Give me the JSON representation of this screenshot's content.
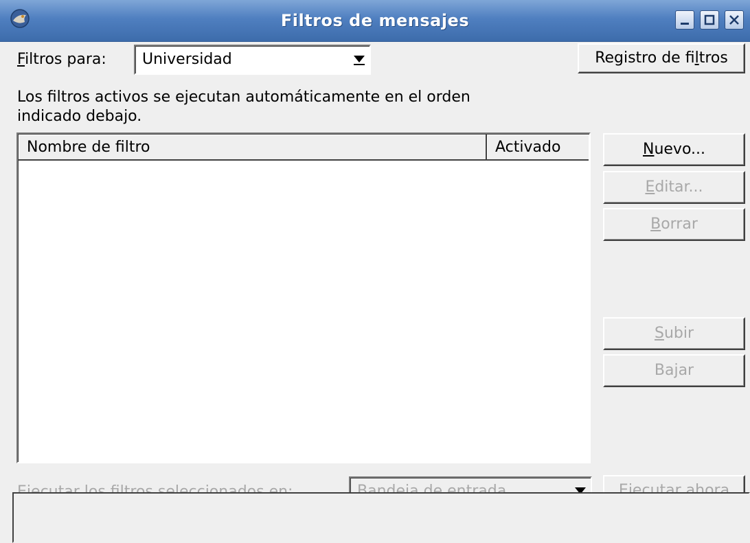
{
  "window": {
    "title": "Filtros de mensajes",
    "controls": [
      "minimize-icon",
      "maximize-icon",
      "close-icon"
    ]
  },
  "filters_for": {
    "label_prefix": "F",
    "label_rest": "iltros para:",
    "account": "Universidad"
  },
  "log_button": {
    "pre": "Registro de fi",
    "u": "l",
    "post": "tros"
  },
  "description": {
    "line1": "Los filtros activos se ejecutan automáticamente en el orden",
    "line2": "indicado debajo."
  },
  "filter_list": {
    "columns": [
      "Nombre de filtro",
      "Activado"
    ],
    "rows": []
  },
  "buttons": {
    "new": {
      "u": "N",
      "rest": "uevo...",
      "enabled": true
    },
    "edit": {
      "u": "E",
      "rest": "ditar...",
      "enabled": false
    },
    "delete": {
      "u": "B",
      "rest": "orrar",
      "enabled": false
    },
    "up": {
      "u": "S",
      "rest": "ubir",
      "enabled": false
    },
    "down": {
      "pre": "Ba",
      "u": "j",
      "post": "ar",
      "enabled": false
    }
  },
  "run": {
    "label_pre": "Eje",
    "label_u": "c",
    "label_post": "utar los filtros seleccionados en:",
    "folder": "Bandeja de entrada",
    "button_pre": "Ejecuta",
    "button_u": "r",
    "button_post": " ahora"
  },
  "status_bar": ""
}
